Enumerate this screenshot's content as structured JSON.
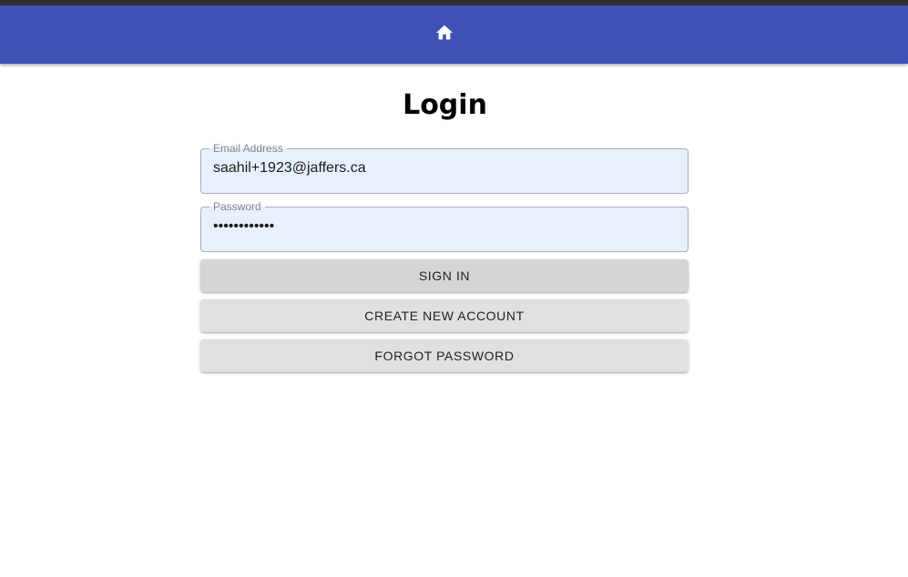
{
  "appbar": {
    "home_icon": "home-icon",
    "color": "#3f51b5"
  },
  "login": {
    "title": "Login",
    "email": {
      "label": "Email Address",
      "value": "saahil+1923@jaffers.ca"
    },
    "password": {
      "label": "Password",
      "value": "••••••••••••"
    },
    "buttons": {
      "sign_in": "SIGN IN",
      "create_account": "CREATE NEW ACCOUNT",
      "forgot_password": "FORGOT PASSWORD"
    }
  }
}
